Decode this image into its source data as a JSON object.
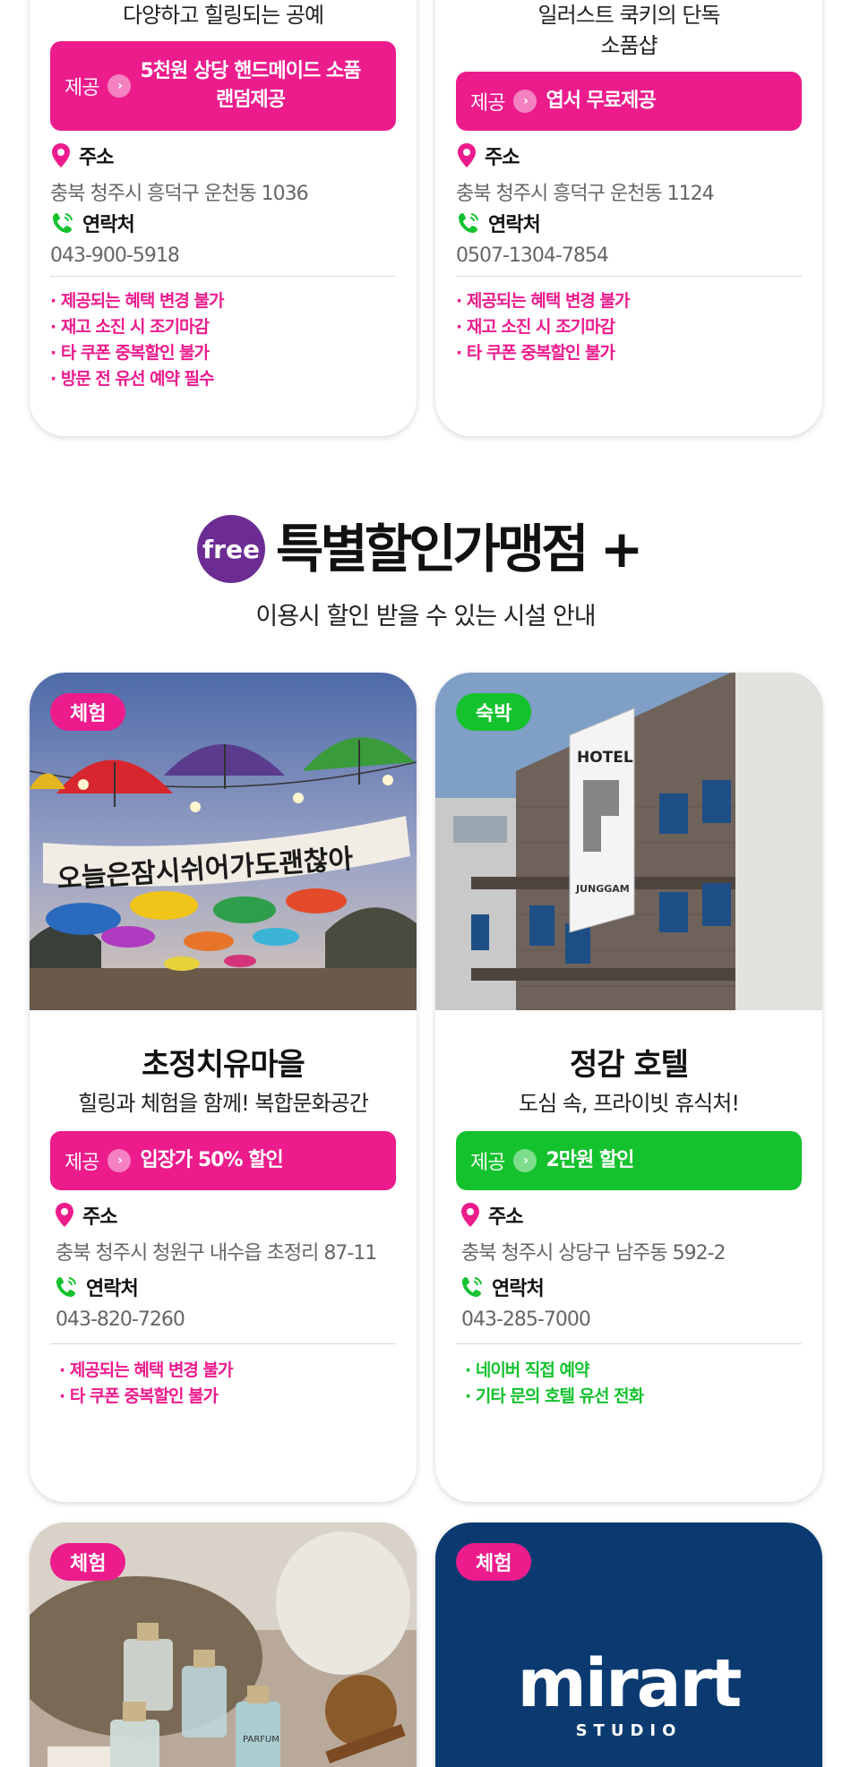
{
  "top_cards": [
    {
      "subtitle": [
        "다양하고 힐링되는 공예"
      ],
      "offer_label": "제공",
      "offer_text": [
        "5천원 상당 핸드메이드 소품",
        "랜덤제공"
      ],
      "address_label": "주소",
      "address": "충북 청주시 흥덕구 운천동 1036",
      "contact_label": "연락처",
      "contact": "043-900-5918",
      "notes": [
        "· 제공되는 혜택 변경 불가",
        "· 재고 소진 시 조기마감",
        "· 타 쿠폰 중복할인 불가",
        "· 방문 전 유선 예약 필수"
      ]
    },
    {
      "subtitle": [
        "일러스트 쿡키의 단독",
        "소품샵"
      ],
      "offer_label": "제공",
      "offer_text": [
        "엽서 무료제공"
      ],
      "address_label": "주소",
      "address": "충북 청주시 흥덕구 운천동 1124",
      "contact_label": "연락처",
      "contact": "0507-1304-7854",
      "notes": [
        "· 제공되는 혜택 변경 불가",
        "· 재고 소진 시 조기마감",
        "· 타 쿠폰 중복할인 불가"
      ]
    }
  ],
  "section": {
    "badge": "free",
    "title": "특별할인가맹점 +",
    "subtitle": "이용시 할인 받을 수 있는 시설 안내"
  },
  "mid_cards": [
    {
      "tag": "체험",
      "photo_text": "오늘은잠시쉬어가도괜찮아",
      "name": "초정치유마을",
      "subtitle": "힐링과 체험을 함께! 복합문화공간",
      "offer_label": "제공",
      "offer_text": "입장가 50% 할인",
      "address_label": "주소",
      "address": "충북 청주시 청원구 내수읍 초정리 87-11",
      "contact_label": "연락처",
      "contact": "043-820-7260",
      "notes": [
        "· 제공되는 혜택 변경 불가",
        "· 타 쿠폰 중복할인 불가"
      ]
    },
    {
      "tag": "숙박",
      "photo_text_hotel": "HOTEL",
      "photo_text_brand": "JUNGGAM",
      "name": "정감 호텔",
      "subtitle": "도심 속, 프라이빗 휴식처!",
      "offer_label": "제공",
      "offer_text": "2만원 할인",
      "address_label": "주소",
      "address": "충북 청주시 상당구 남주동 592-2",
      "contact_label": "연락처",
      "contact": "043-285-7000",
      "notes": [
        "· 네이버 직접 예약",
        "· 기타 문의 호텔 유선 전화"
      ]
    }
  ],
  "bottom_cards": [
    {
      "tag": "체험",
      "photo_text": "PARFUM"
    },
    {
      "tag": "체험",
      "logo": "mirart",
      "logo_sub": "STUDIO"
    }
  ],
  "colors": {
    "pink": "#ec1c8d",
    "green": "#14c22e",
    "purple": "#6c2c93",
    "navy": "#0b3a70"
  },
  "icons": [
    "location-pin-icon",
    "phone-icon",
    "chevron-right-icon"
  ]
}
